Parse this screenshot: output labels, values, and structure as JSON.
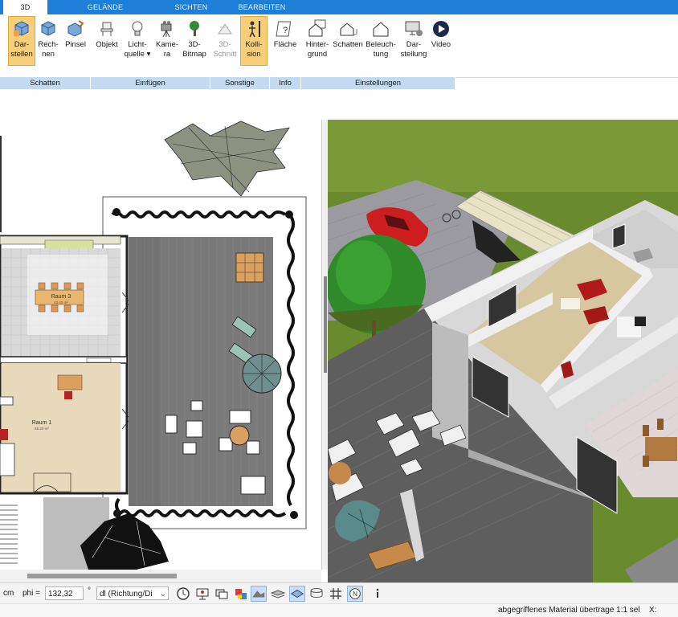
{
  "ribbon": {
    "tabs": [
      "3D",
      "GELÄNDE",
      "SICHTEN",
      "BEARBEITEN"
    ],
    "buttons": [
      {
        "line1": "Dar-",
        "line2": "stellen",
        "icon": "cube-display-icon"
      },
      {
        "line1": "Rech-",
        "line2": "nen",
        "icon": "cube-compute-icon"
      },
      {
        "line1": "Pinsel",
        "line2": "",
        "icon": "cube-brush-icon"
      },
      {
        "line1": "Objekt",
        "line2": "",
        "icon": "chair-icon"
      },
      {
        "line1": "Licht-",
        "line2": "quelle ▾",
        "icon": "light-bulb-icon"
      },
      {
        "line1": "Kame-",
        "line2": "ra",
        "icon": "camera-icon"
      },
      {
        "line1": "3D-",
        "line2": "Bitmap",
        "icon": "tree-icon"
      },
      {
        "line1": "3D-",
        "line2": "Schnitt",
        "icon": "section-icon"
      },
      {
        "line1": "Kolli-",
        "line2": "sion",
        "icon": "collision-person-icon"
      },
      {
        "line1": "Fläche",
        "line2": "",
        "icon": "area-help-icon"
      },
      {
        "line1": "Hinter-",
        "line2": "grund",
        "icon": "house-background-icon"
      },
      {
        "line1": "Schatten",
        "line2": "",
        "icon": "house-shadow-icon"
      },
      {
        "line1": "Beleuch-",
        "line2": "tung",
        "icon": "house-lighting-icon"
      },
      {
        "line1": "Dar-",
        "line2": "stellung",
        "icon": "monitor-settings-icon"
      },
      {
        "line1": "Video",
        "line2": "",
        "icon": "play-icon"
      }
    ],
    "groups": [
      "Schatten",
      "Einfügen",
      "Sonstige",
      "Info",
      "Einstellungen"
    ]
  },
  "plan": {
    "room3_label": "Raum 3",
    "room3_area": "43.42 m²",
    "room1_label": "Raum 1",
    "room1_area": "66.20 m²"
  },
  "bottombar": {
    "unit": "cm",
    "phi_label": "phi =",
    "phi_value": "132,32",
    "degree": "°",
    "direction_value": "dl (Richtung/Di"
  },
  "status": {
    "message": "abgegriffenes Material übertrage 1:1 sel",
    "coord_label": "X:"
  },
  "colors": {
    "tab_blue": "#1e7fd8",
    "group_blue": "#c3daf1",
    "selected_orange": "#f7cf7a",
    "grass": "#6a8a2e",
    "deck": "#5e5e5e"
  }
}
